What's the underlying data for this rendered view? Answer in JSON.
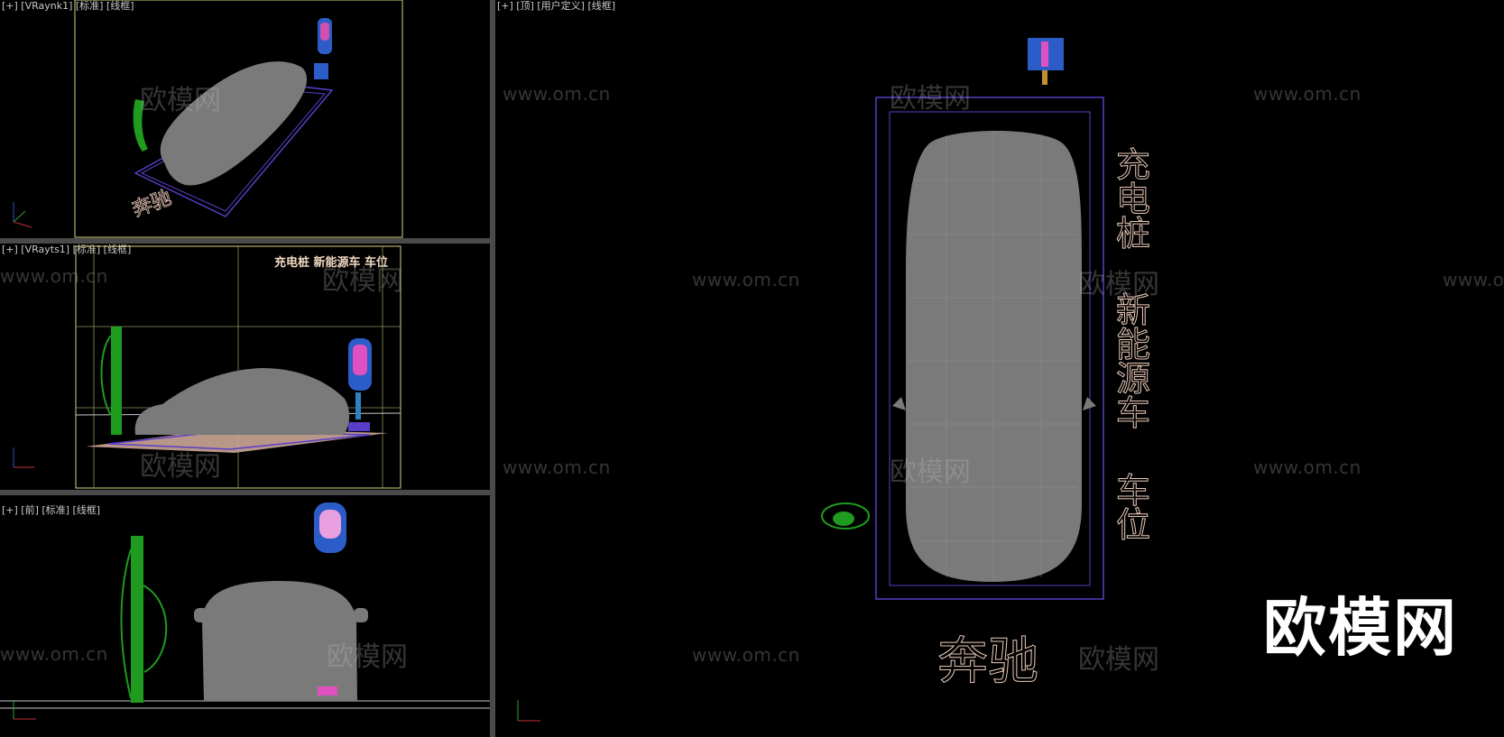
{
  "viewports": {
    "perspective": {
      "label": "[+] [VRaynk1] [标准] [线框]"
    },
    "camera": {
      "label": "[+] [VRayts1] [标准] [线框]",
      "overlay_text": "充电桩 新能源车 车位"
    },
    "front": {
      "label": "[+] [前] [标准] [线框]"
    },
    "top": {
      "label": "[+] [顶] [用户定义] [线框]"
    }
  },
  "scene_text": {
    "brand": "奔驰",
    "vertical_1": "充电桩",
    "vertical_2": "新能源车",
    "vertical_3": "车位"
  },
  "watermark": {
    "url": "www.om.cn",
    "cn": "欧模网",
    "logo": "欧模网"
  },
  "axis": {
    "x": "x",
    "y": "y",
    "z": "z"
  },
  "colors": {
    "wireframe_gray": "#7a7a7a",
    "charger_green": "#1f9b1f",
    "charger_blue": "#2c5cc8",
    "parking_purple": "#5a3ec8",
    "outline_text": "#e8c8b8",
    "frame_yellow": "#d8d080"
  }
}
